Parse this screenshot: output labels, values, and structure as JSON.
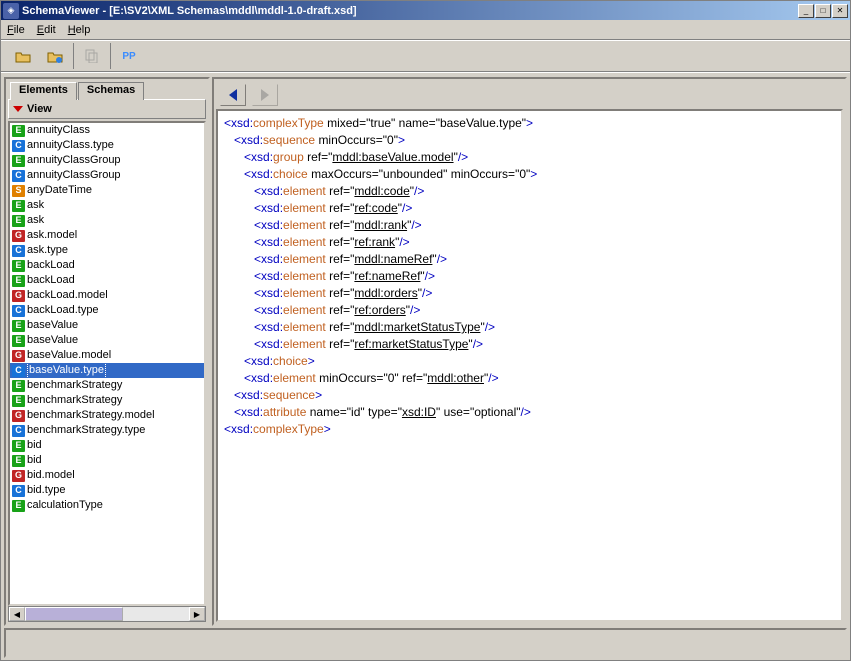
{
  "title": "SchemaViewer - [E:\\SV2\\XML Schemas\\mddl\\mddl-1.0-draft.xsd]",
  "menu": {
    "file": "File",
    "edit": "Edit",
    "help": "Help"
  },
  "toolbar": {
    "pp_label": "PP"
  },
  "sidebar": {
    "tabs": {
      "elements": "Elements",
      "schemas": "Schemas"
    },
    "view_label": "View",
    "items": [
      {
        "icon": "E",
        "label": "annuityClass"
      },
      {
        "icon": "C",
        "label": "annuityClass.type"
      },
      {
        "icon": "E",
        "label": "annuityClassGroup"
      },
      {
        "icon": "C",
        "label": "annuityClassGroup"
      },
      {
        "icon": "S",
        "label": "anyDateTime"
      },
      {
        "icon": "E",
        "label": "ask"
      },
      {
        "icon": "E",
        "label": "ask"
      },
      {
        "icon": "G",
        "label": "ask.model"
      },
      {
        "icon": "C",
        "label": "ask.type"
      },
      {
        "icon": "E",
        "label": "backLoad"
      },
      {
        "icon": "E",
        "label": "backLoad"
      },
      {
        "icon": "G",
        "label": "backLoad.model"
      },
      {
        "icon": "C",
        "label": "backLoad.type"
      },
      {
        "icon": "E",
        "label": "baseValue"
      },
      {
        "icon": "E",
        "label": "baseValue"
      },
      {
        "icon": "G",
        "label": "baseValue.model"
      },
      {
        "icon": "C",
        "label": "baseValue.type",
        "selected": true
      },
      {
        "icon": "E",
        "label": "benchmarkStrategy"
      },
      {
        "icon": "E",
        "label": "benchmarkStrategy"
      },
      {
        "icon": "G",
        "label": "benchmarkStrategy.model"
      },
      {
        "icon": "C",
        "label": "benchmarkStrategy.type"
      },
      {
        "icon": "E",
        "label": "bid"
      },
      {
        "icon": "E",
        "label": "bid"
      },
      {
        "icon": "G",
        "label": "bid.model"
      },
      {
        "icon": "C",
        "label": "bid.type"
      },
      {
        "icon": "E",
        "label": "calculationType"
      }
    ]
  },
  "code": {
    "lines": [
      {
        "indent": 0,
        "open": "<",
        "ns": "xsd:",
        "tag": "complexType",
        "attrs": [
          {
            "n": "mixed",
            "v": "\"true\""
          },
          {
            "n": "name",
            "v": "\"baseValue.type\""
          }
        ],
        "close": ">"
      },
      {
        "indent": 1,
        "open": "<",
        "ns": "xsd:",
        "tag": "sequence",
        "attrs": [
          {
            "n": "minOccurs",
            "v": "\"0\""
          }
        ],
        "close": ">"
      },
      {
        "indent": 2,
        "open": "<",
        "ns": "xsd:",
        "tag": "group",
        "attrs": [
          {
            "n": "ref",
            "ref": "mddl:baseValue.model"
          }
        ],
        "close": "/>"
      },
      {
        "indent": 2,
        "open": "<",
        "ns": "xsd:",
        "tag": "choice",
        "attrs": [
          {
            "n": "maxOccurs",
            "v": "\"unbounded\""
          },
          {
            "n": "minOccurs",
            "v": "\"0\""
          }
        ],
        "close": ">"
      },
      {
        "indent": 3,
        "open": "<",
        "ns": "xsd:",
        "tag": "element",
        "attrs": [
          {
            "n": "ref",
            "ref": "mddl:code"
          }
        ],
        "close": "/>"
      },
      {
        "indent": 3,
        "open": "<",
        "ns": "xsd:",
        "tag": "element",
        "attrs": [
          {
            "n": "ref",
            "ref": "ref:code"
          }
        ],
        "close": "/>"
      },
      {
        "indent": 3,
        "open": "<",
        "ns": "xsd:",
        "tag": "element",
        "attrs": [
          {
            "n": "ref",
            "ref": "mddl:rank"
          }
        ],
        "close": "/>"
      },
      {
        "indent": 3,
        "open": "<",
        "ns": "xsd:",
        "tag": "element",
        "attrs": [
          {
            "n": "ref",
            "ref": "ref:rank"
          }
        ],
        "close": "/>"
      },
      {
        "indent": 3,
        "open": "<",
        "ns": "xsd:",
        "tag": "element",
        "attrs": [
          {
            "n": "ref",
            "ref": "mddl:nameRef"
          }
        ],
        "close": "/>"
      },
      {
        "indent": 3,
        "open": "<",
        "ns": "xsd:",
        "tag": "element",
        "attrs": [
          {
            "n": "ref",
            "ref": "ref:nameRef"
          }
        ],
        "close": "/>"
      },
      {
        "indent": 3,
        "open": "<",
        "ns": "xsd:",
        "tag": "element",
        "attrs": [
          {
            "n": "ref",
            "ref": "mddl:orders"
          }
        ],
        "close": "/>"
      },
      {
        "indent": 3,
        "open": "<",
        "ns": "xsd:",
        "tag": "element",
        "attrs": [
          {
            "n": "ref",
            "ref": "ref:orders"
          }
        ],
        "close": "/>"
      },
      {
        "indent": 3,
        "open": "<",
        "ns": "xsd:",
        "tag": "element",
        "attrs": [
          {
            "n": "ref",
            "ref": "mddl:marketStatusType"
          }
        ],
        "close": "/>"
      },
      {
        "indent": 3,
        "open": "<",
        "ns": "xsd:",
        "tag": "element",
        "attrs": [
          {
            "n": "ref",
            "ref": "ref:marketStatusType"
          }
        ],
        "close": "/>"
      },
      {
        "indent": 2,
        "open": "<",
        "ns": "xsd:",
        "tag": "choice",
        "attrs": [],
        "close": ">"
      },
      {
        "indent": 2,
        "open": "<",
        "ns": "xsd:",
        "tag": "element",
        "attrs": [
          {
            "n": "minOccurs",
            "v": "\"0\""
          },
          {
            "n": "ref",
            "ref": "mddl:other"
          }
        ],
        "close": "/>"
      },
      {
        "indent": 1,
        "open": "<",
        "ns": "xsd:",
        "tag": "sequence",
        "attrs": [],
        "close": ">"
      },
      {
        "indent": 1,
        "open": "<",
        "ns": "xsd:",
        "tag": "attribute",
        "attrs": [
          {
            "n": "name",
            "v": "\"id\""
          },
          {
            "n": "type",
            "ref": "xsd:ID"
          },
          {
            "n": "use",
            "v": "\"optional\""
          }
        ],
        "close": "/>"
      },
      {
        "indent": 0,
        "open": "<",
        "ns": "xsd:",
        "tag": "complexType",
        "attrs": [],
        "close": ">"
      }
    ]
  }
}
